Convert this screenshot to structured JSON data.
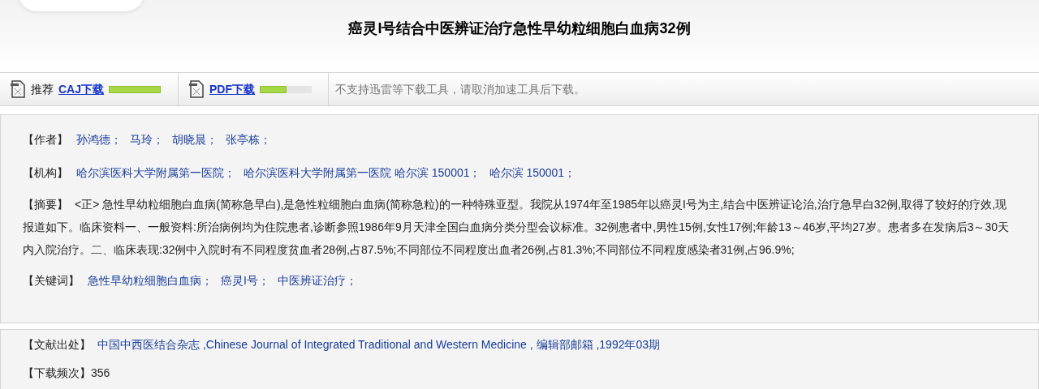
{
  "title": "癌灵I号结合中医辨证治疗急性早幼粒细胞白血病32例",
  "downloads": [
    {
      "prefix": "推荐",
      "label": "CAJ下载",
      "level": 1.0
    },
    {
      "label": "PDF下载",
      "level": 0.52
    }
  ],
  "notice": "不支持迅雷等下载工具，请取消加速工具后下载。",
  "authors": {
    "label": "【作者】",
    "items": [
      "孙鸿德；",
      "马玲；",
      "胡晓晨；",
      "张亭栋；"
    ]
  },
  "institutions": {
    "label": "【机构】",
    "items": [
      "哈尔滨医科大学附属第一医院；",
      "哈尔滨医科大学附属第一医院 哈尔滨 150001；",
      "哈尔滨 150001；"
    ]
  },
  "abstract": {
    "label": "【摘要】",
    "text": "<正> 急性早幼粒细胞白血病(简称急早白),是急性粒细胞白血病(简称急粒)的一种特殊亚型。我院从1974年至1985年以癌灵I号为主,结合中医辨证论治,治疗急早白32例,取得了较好的疗效,现报道如下。临床资料一、一般资料:所治病例均为住院患者,诊断参照1986年9月天津全国白血病分类分型会议标准。32例患者中,男性15例,女性17例;年龄13～46岁,平均27岁。患者多在发病后3～30天内入院治疗。二、临床表现:32例中入院时有不同程度贫血者28例,占87.5%;不同部位不同程度出血者26例,占81.3%;不同部位不同程度感染者31例,占96.9%;"
  },
  "keywords": {
    "label": "【关键词】",
    "items": [
      "急性早幼粒细胞白血病；",
      "癌灵I号；",
      "中医辨证治疗；"
    ]
  },
  "source": {
    "label": "【文献出处】",
    "text": "中国中西医结合杂志 ,Chinese Journal of Integrated Traditional and Western Medicine , 编辑部邮箱 ,1992年03期"
  },
  "download_count": {
    "label": "【下载频次】",
    "value": "356"
  }
}
